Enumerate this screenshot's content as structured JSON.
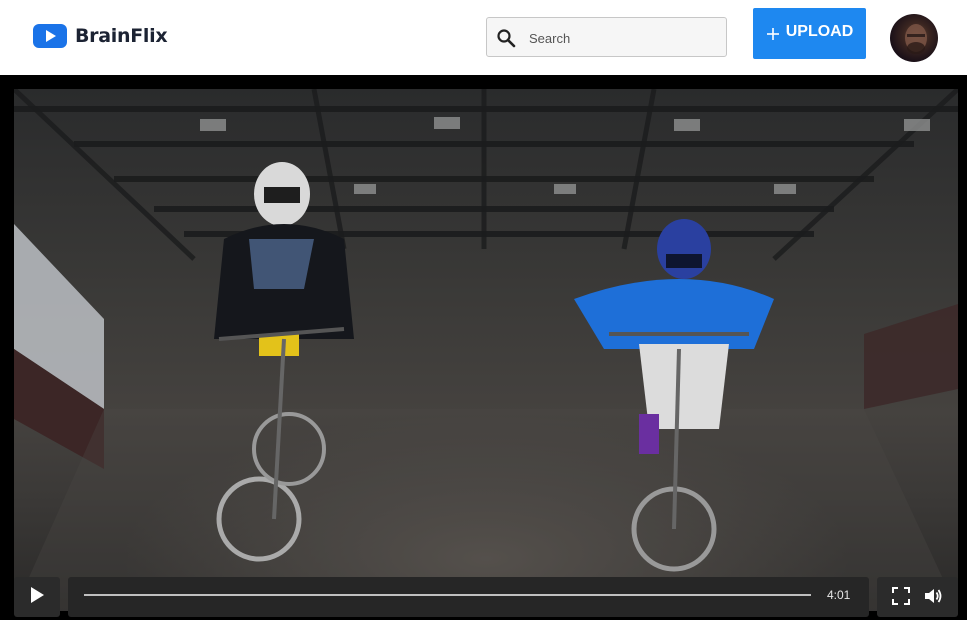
{
  "app": {
    "name": "BrainFlix"
  },
  "header": {
    "search": {
      "placeholder": "Search"
    },
    "upload_label": "UPLOAD"
  },
  "player": {
    "duration": "4:01",
    "progress": 0
  },
  "colors": {
    "brand_blue": "#1a73e8",
    "upload_blue": "#1e88f0",
    "control_bg": "#2b2b2b"
  },
  "icons": [
    "play-icon",
    "search-icon",
    "plus-icon",
    "fullscreen-icon",
    "volume-icon"
  ]
}
